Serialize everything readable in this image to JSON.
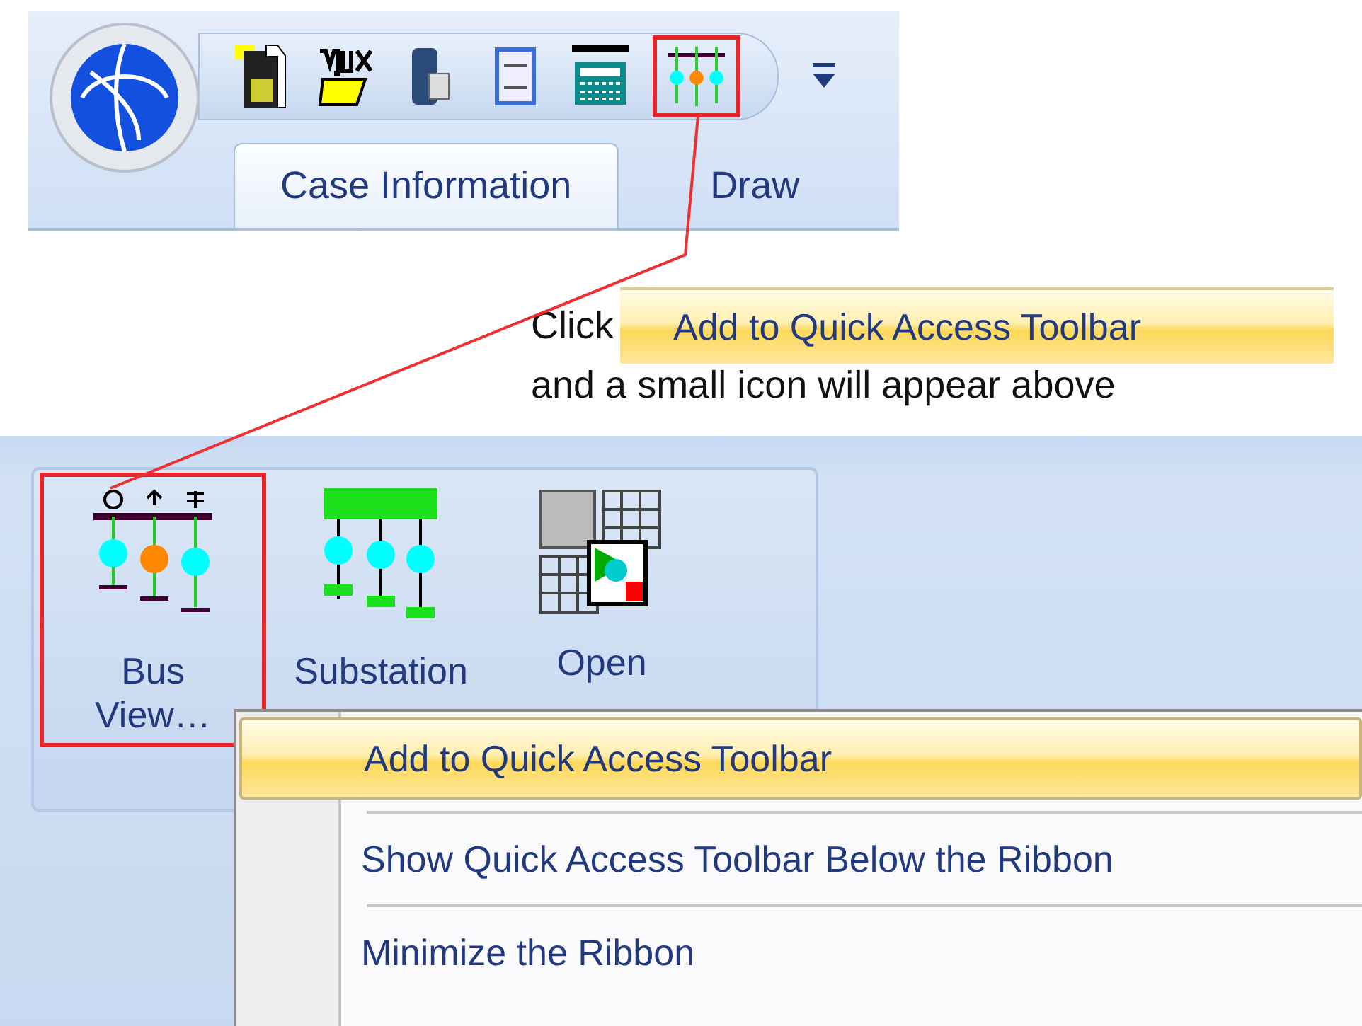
{
  "quick_access_toolbar": {
    "items": [
      {
        "kind": "save",
        "highlighted": false
      },
      {
        "kind": "aux",
        "highlighted": false
      },
      {
        "kind": "database",
        "highlighted": false
      },
      {
        "kind": "log",
        "highlighted": false
      },
      {
        "kind": "solve",
        "highlighted": false
      },
      {
        "kind": "bus-view",
        "highlighted": true
      }
    ]
  },
  "tabs": [
    {
      "label": "Case Information",
      "selected": true
    },
    {
      "label": "Draw",
      "selected": false
    }
  ],
  "instruction": {
    "prefix": "Click",
    "menu_item": "Add to Quick Access Toolbar",
    "line_2": "and a small icon will appear above"
  },
  "ribbon_buttons": [
    {
      "kind": "bus-view",
      "lines": [
        "Bus",
        "View…"
      ],
      "highlighted": true
    },
    {
      "kind": "substation",
      "lines": [
        "Substation"
      ],
      "highlighted": false
    },
    {
      "kind": "open-windows",
      "lines": [
        "Open"
      ],
      "highlighted": false
    }
  ],
  "context_menu": [
    {
      "label": "Add to Quick Access Toolbar",
      "selected": true
    },
    {
      "label": "Show Quick Access Toolbar Below the Ribbon",
      "selected": false
    },
    {
      "label": "Minimize the Ribbon",
      "selected": false
    }
  ]
}
